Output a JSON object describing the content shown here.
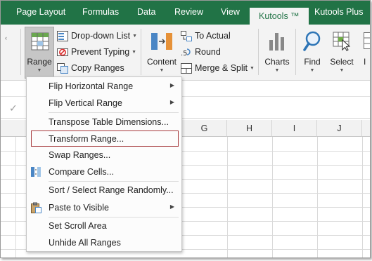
{
  "tabs": [
    "Page Layout",
    "Formulas",
    "Data",
    "Review",
    "View",
    "Kutools ™",
    "Kutools Plus"
  ],
  "active_tab": "Kutools ™",
  "ribbon": {
    "range_label": "Range",
    "dropdown_list": "Drop-down List",
    "prevent_typing": "Prevent Typing",
    "copy_ranges": "Copy Ranges",
    "content_label": "Content",
    "to_actual": "To Actual",
    "round": "Round",
    "merge_split": "Merge & Split",
    "charts_label": "Charts",
    "find_label": "Find",
    "select_label": "Select",
    "partial_label": "I"
  },
  "columns": [
    "G",
    "H",
    "I",
    "J"
  ],
  "menu": {
    "items": [
      {
        "label": "Flip Horizontal Range",
        "submenu": true
      },
      {
        "label": "Flip Vertical Range",
        "submenu": true
      },
      {
        "label": "Transpose Table Dimensions...",
        "submenu": false
      },
      {
        "label": "Transform Range...",
        "submenu": false
      },
      {
        "label": "Swap Ranges...",
        "submenu": false
      },
      {
        "label": "Compare Cells...",
        "submenu": false
      },
      {
        "label": "Sort / Select Range Randomly...",
        "submenu": false
      },
      {
        "label": "Paste to Visible",
        "submenu": true
      },
      {
        "label": "Set Scroll Area",
        "submenu": false
      },
      {
        "label": "Unhide All Ranges",
        "submenu": false
      }
    ],
    "highlighted": "Transform Range...",
    "arrow_glyph": "▶"
  },
  "colors": {
    "tab_bar": "#217346",
    "ribbon": "#f3f3f3",
    "highlight_border": "#a5373a"
  }
}
